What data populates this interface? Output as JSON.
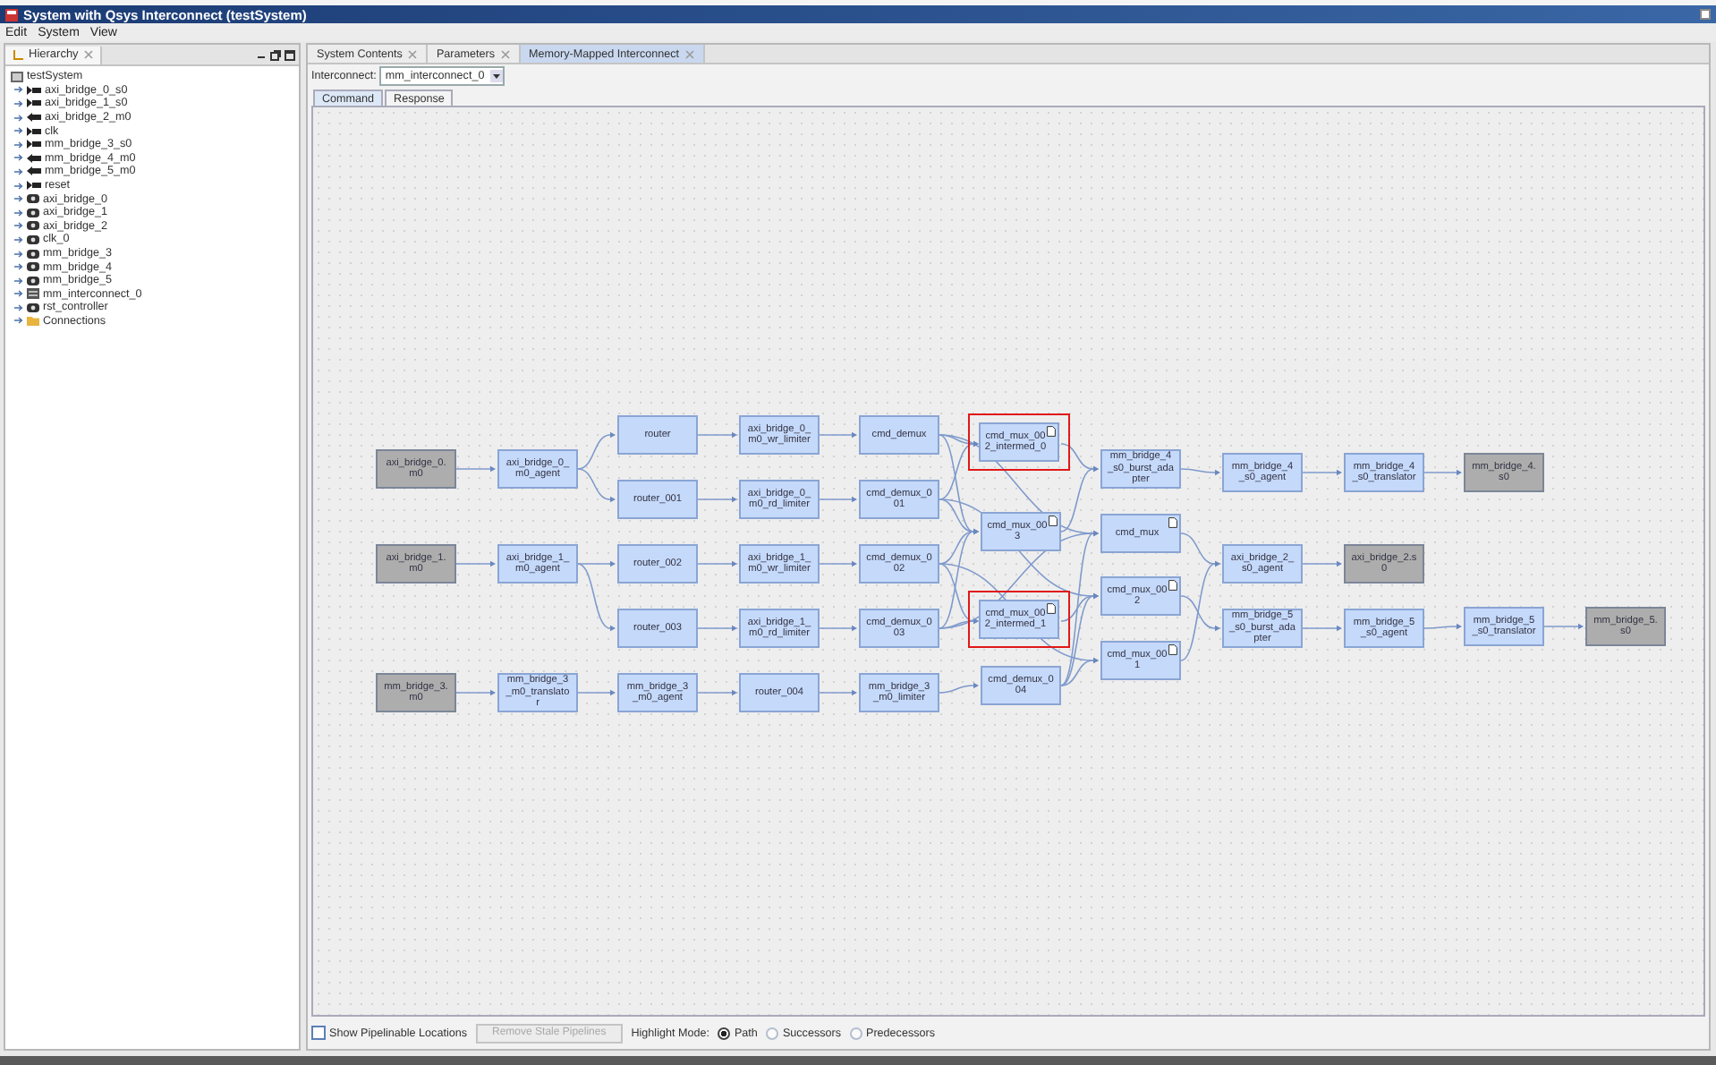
{
  "window": {
    "title": "System with Qsys Interconnect (testSystem)"
  },
  "menu": [
    "Edit",
    "System",
    "View"
  ],
  "hierarchy": {
    "tab": "Hierarchy",
    "root": {
      "label": "testSystem",
      "children": [
        {
          "label": "axi_bridge_0_s0",
          "kind": "input"
        },
        {
          "label": "axi_bridge_1_s0",
          "kind": "input"
        },
        {
          "label": "axi_bridge_2_m0",
          "kind": "output"
        },
        {
          "label": "clk",
          "kind": "input"
        },
        {
          "label": "mm_bridge_3_s0",
          "kind": "input"
        },
        {
          "label": "mm_bridge_4_m0",
          "kind": "output"
        },
        {
          "label": "mm_bridge_5_m0",
          "kind": "output"
        },
        {
          "label": "reset",
          "kind": "input"
        },
        {
          "label": "axi_bridge_0",
          "kind": "module"
        },
        {
          "label": "axi_bridge_1",
          "kind": "module"
        },
        {
          "label": "axi_bridge_2",
          "kind": "module"
        },
        {
          "label": "clk_0",
          "kind": "module"
        },
        {
          "label": "mm_bridge_3",
          "kind": "module"
        },
        {
          "label": "mm_bridge_4",
          "kind": "module"
        },
        {
          "label": "mm_bridge_5",
          "kind": "module"
        },
        {
          "label": "mm_interconnect_0",
          "kind": "interconnect"
        },
        {
          "label": "rst_controller",
          "kind": "module"
        },
        {
          "label": "Connections",
          "kind": "folder"
        }
      ]
    }
  },
  "tabs": [
    {
      "label": "System Contents",
      "selected": false
    },
    {
      "label": "Parameters",
      "selected": false
    },
    {
      "label": "Memory-Mapped Interconnect",
      "selected": true
    }
  ],
  "interconnect": {
    "label": "Interconnect:",
    "value": "mm_interconnect_0"
  },
  "subtabs": [
    {
      "label": "Command",
      "selected": true
    },
    {
      "label": "Response",
      "selected": false
    }
  ],
  "diagram": {
    "nodes": [
      {
        "label": "axi_bridge_0.m0",
        "kind": "endpoint",
        "highlighted": false,
        "marker": false
      },
      {
        "label": "axi_bridge_0_m0_agent",
        "kind": "component",
        "highlighted": false,
        "marker": false
      },
      {
        "label": "router",
        "kind": "component",
        "highlighted": false,
        "marker": false
      },
      {
        "label": "axi_bridge_0_m0_wr_limiter",
        "kind": "component",
        "highlighted": false,
        "marker": false
      },
      {
        "label": "cmd_demux",
        "kind": "component",
        "highlighted": false,
        "marker": false
      },
      {
        "label": "router_001",
        "kind": "component",
        "highlighted": false,
        "marker": false
      },
      {
        "label": "axi_bridge_0_m0_rd_limiter",
        "kind": "component",
        "highlighted": false,
        "marker": false
      },
      {
        "label": "cmd_demux_001",
        "kind": "component",
        "highlighted": false,
        "marker": false
      },
      {
        "label": "axi_bridge_1.m0",
        "kind": "endpoint",
        "highlighted": false,
        "marker": false
      },
      {
        "label": "axi_bridge_1_m0_agent",
        "kind": "component",
        "highlighted": false,
        "marker": false
      },
      {
        "label": "router_002",
        "kind": "component",
        "highlighted": false,
        "marker": false
      },
      {
        "label": "axi_bridge_1_m0_wr_limiter",
        "kind": "component",
        "highlighted": false,
        "marker": false
      },
      {
        "label": "cmd_demux_002",
        "kind": "component",
        "highlighted": false,
        "marker": false
      },
      {
        "label": "router_003",
        "kind": "component",
        "highlighted": false,
        "marker": false
      },
      {
        "label": "axi_bridge_1_m0_rd_limiter",
        "kind": "component",
        "highlighted": false,
        "marker": false
      },
      {
        "label": "cmd_demux_003",
        "kind": "component",
        "highlighted": false,
        "marker": false
      },
      {
        "label": "mm_bridge_3.m0",
        "kind": "endpoint",
        "highlighted": false,
        "marker": false
      },
      {
        "label": "mm_bridge_3_m0_translator",
        "kind": "component",
        "highlighted": false,
        "marker": false
      },
      {
        "label": "mm_bridge_3_m0_agent",
        "kind": "component",
        "highlighted": false,
        "marker": false
      },
      {
        "label": "router_004",
        "kind": "component",
        "highlighted": false,
        "marker": false
      },
      {
        "label": "mm_bridge_3_m0_limiter",
        "kind": "component",
        "highlighted": false,
        "marker": false
      },
      {
        "label": "cmd_mux_002_intermed_0",
        "kind": "component",
        "highlighted": true,
        "marker": true
      },
      {
        "label": "cmd_mux_003",
        "kind": "component",
        "highlighted": false,
        "marker": true
      },
      {
        "label": "cmd_mux_002_intermed_1",
        "kind": "component",
        "highlighted": true,
        "marker": true
      },
      {
        "label": "cmd_demux_004",
        "kind": "component",
        "highlighted": false,
        "marker": false
      },
      {
        "label": "mm_bridge_4_s0_burst_adapter",
        "kind": "component",
        "highlighted": false,
        "marker": false
      },
      {
        "label": "cmd_mux",
        "kind": "component",
        "highlighted": false,
        "marker": true
      },
      {
        "label": "cmd_mux_002",
        "kind": "component",
        "highlighted": false,
        "marker": true
      },
      {
        "label": "cmd_mux_001",
        "kind": "component",
        "highlighted": false,
        "marker": true
      },
      {
        "label": "mm_bridge_4_s0_agent",
        "kind": "component",
        "highlighted": false,
        "marker": false
      },
      {
        "label": "mm_bridge_4_s0_translator",
        "kind": "component",
        "highlighted": false,
        "marker": false
      },
      {
        "label": "mm_bridge_4.s0",
        "kind": "endpoint",
        "highlighted": false,
        "marker": false
      },
      {
        "label": "axi_bridge_2_s0_agent",
        "kind": "component",
        "highlighted": false,
        "marker": false
      },
      {
        "label": "axi_bridge_2.s0",
        "kind": "endpoint",
        "highlighted": false,
        "marker": false
      },
      {
        "label": "mm_bridge_5_s0_burst_adapter",
        "kind": "component",
        "highlighted": false,
        "marker": false
      },
      {
        "label": "mm_bridge_5_s0_agent",
        "kind": "component",
        "highlighted": false,
        "marker": false
      },
      {
        "label": "mm_bridge_5_s0_translator",
        "kind": "component",
        "highlighted": false,
        "marker": false
      },
      {
        "label": "mm_bridge_5.s0",
        "kind": "endpoint",
        "highlighted": false,
        "marker": false
      }
    ]
  },
  "footer": {
    "show_pipelinable": {
      "label": "Show Pipelinable Locations",
      "checked": false
    },
    "remove_button": {
      "label": "Remove Stale Pipelines",
      "disabled": true
    },
    "highlight_mode": {
      "label": "Highlight Mode:",
      "options": [
        {
          "label": "Path",
          "selected": true
        },
        {
          "label": "Successors",
          "selected": false
        },
        {
          "label": "Predecessors",
          "selected": false
        }
      ]
    }
  }
}
